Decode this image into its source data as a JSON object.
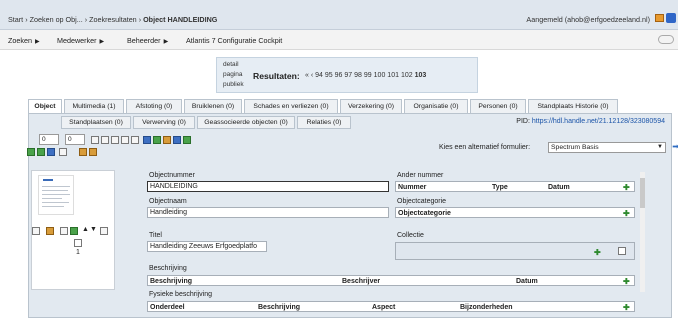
{
  "breadcrumb": {
    "items": [
      "Start",
      "Zoeken op Obj...",
      "Zoekresultaten"
    ],
    "separator": "›",
    "current": "Object HANDLEIDING"
  },
  "login": {
    "text": "Aangemeld (ahob@erfgoedzeeland.nl)"
  },
  "menu": {
    "items": [
      {
        "label": "Zoeken",
        "has_arrow": true
      },
      {
        "label": "Medewerker",
        "has_arrow": true
      },
      {
        "label": "Beheerder",
        "has_arrow": true
      },
      {
        "label": "Atlantis 7 Configuratie Cockpit",
        "has_arrow": false
      }
    ],
    "arrow": "▶"
  },
  "results": {
    "labels": [
      "detail",
      "pagina",
      "publiek"
    ],
    "title": "Resultaten:",
    "nav_first": "«",
    "nav_prev": "‹",
    "pages": [
      "94",
      "95",
      "96",
      "97",
      "98",
      "99",
      "100",
      "101",
      "102"
    ],
    "current_page": "103"
  },
  "tabs_row1": [
    {
      "label": "Object",
      "active": true
    },
    {
      "label": "Multimedia (1)"
    },
    {
      "label": "Afstoting (0)"
    },
    {
      "label": "Bruiklenen (0)"
    },
    {
      "label": "Schades en verliezen (0)"
    },
    {
      "label": "Verzekering (0)"
    },
    {
      "label": "Organisatie (0)"
    },
    {
      "label": "Personen (0)"
    },
    {
      "label": "Standplaats Historie (0)"
    }
  ],
  "tabs_row2": [
    {
      "label": "Standplaatsen (0)"
    },
    {
      "label": "Verwerving (0)"
    },
    {
      "label": "Geassocieerde objecten (0)"
    },
    {
      "label": "Relaties (0)"
    }
  ],
  "pid": {
    "label": "PID:",
    "url": "https://hdl.handle.net/21.12128/323080594"
  },
  "toolbar": {
    "count_a": "0",
    "count_b": "0"
  },
  "alt_form": {
    "label": "Kies een alternatief formulier:",
    "value": "Spectrum Basis"
  },
  "thumbnail": {
    "index": "1"
  },
  "fields": {
    "objectnummer": {
      "label": "Objectnummer",
      "value": "HANDLEIDING"
    },
    "objectnaam": {
      "label": "Objectnaam",
      "value": "Handleiding"
    },
    "titel": {
      "label": "Titel",
      "value": "Handleiding Zeeuws Erfgoedplatfo"
    },
    "ander_nummer": {
      "label": "Ander nummer",
      "cols": [
        "Nummer",
        "Type",
        "Datum"
      ]
    },
    "objectcategorie": {
      "label": "Objectcategorie",
      "col": "Objectcategorie"
    },
    "collectie": {
      "label": "Collectie"
    },
    "beschrijving": {
      "label": "Beschrijving",
      "cols": [
        "Beschrijving",
        "Beschrijver",
        "Datum"
      ]
    },
    "fysieke": {
      "label": "Fysieke beschrijving",
      "cols": [
        "Onderdeel",
        "Beschrijving",
        "Aspect",
        "Bijzonderheden"
      ]
    }
  },
  "plus_icon": "✚",
  "colors": {
    "header_bg": "#dfe6ee",
    "panel_bg": "#e2e9f0",
    "link": "#1b54a8",
    "plus": "#2f8a2f"
  }
}
